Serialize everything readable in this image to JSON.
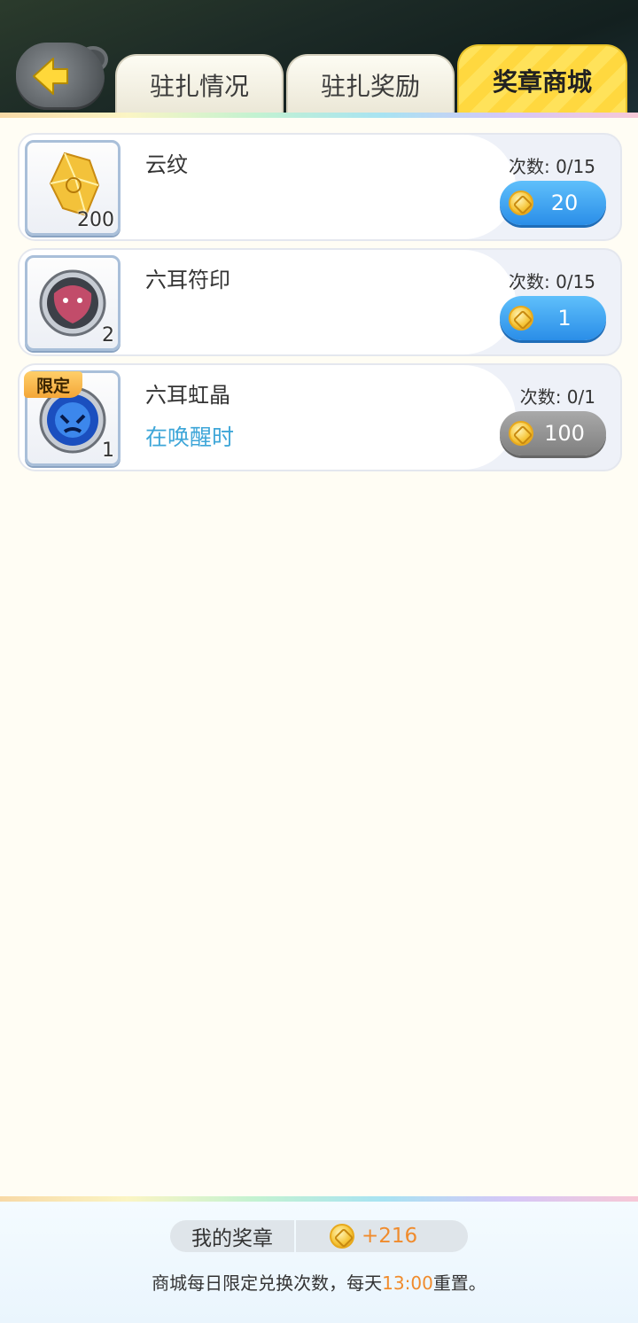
{
  "header": {
    "tabs": [
      {
        "label": "驻扎情况",
        "active": false
      },
      {
        "label": "驻扎奖励",
        "active": false
      },
      {
        "label": "奖章商城",
        "active": true
      }
    ]
  },
  "shop": {
    "items": [
      {
        "name": "云纹",
        "sub": "",
        "quantity": "200",
        "limited": false,
        "count_label": "次数:  0/15",
        "price": "20",
        "price_enabled": true,
        "icon": "gold-crystal-icon"
      },
      {
        "name": "六耳符印",
        "sub": "",
        "quantity": "2",
        "limited": false,
        "count_label": "次数:  0/15",
        "price": "1",
        "price_enabled": true,
        "icon": "monkey-seal-icon"
      },
      {
        "name": "六耳虹晶",
        "sub": "在唤醒时",
        "quantity": "1",
        "limited": true,
        "limited_label": "限定",
        "count_label": "次数:  0/1",
        "price": "100",
        "price_enabled": false,
        "icon": "blue-spirit-crystal-icon"
      }
    ]
  },
  "footer": {
    "medal_label": "我的奖章",
    "medal_value": "+216",
    "note_prefix": "商城每日限定兑换次数，每天",
    "note_time": "13:00",
    "note_suffix": "重置。"
  },
  "colors": {
    "accent_blue": "#2a8ee8",
    "highlight_orange": "#f08b2c",
    "link_blue": "#3ea6d8",
    "tab_active": "#ffd83f"
  }
}
